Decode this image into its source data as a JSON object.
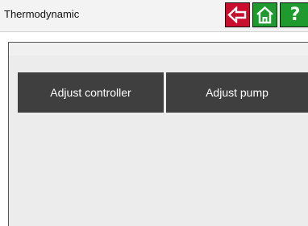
{
  "header": {
    "title": "Thermodynamic",
    "back_icon": "back-arrow-icon",
    "home_icon": "home-icon",
    "help_label": "?",
    "colors": {
      "back": "#c8102e",
      "home": "#1e9a2e",
      "help": "#1e9a2e"
    }
  },
  "tiles": {
    "controller_label": "Adjust controller",
    "pump_label": "Adjust pump",
    "color": "#3f3f3f"
  }
}
